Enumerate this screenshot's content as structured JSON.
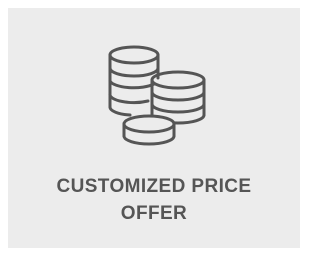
{
  "tile": {
    "icon": "coins-stack-icon",
    "title_line1": "CUSTOMIZED PRICE",
    "title_line2": "OFFER"
  },
  "colors": {
    "background": "#ececec",
    "text": "#555555",
    "icon_stroke": "#555555"
  }
}
